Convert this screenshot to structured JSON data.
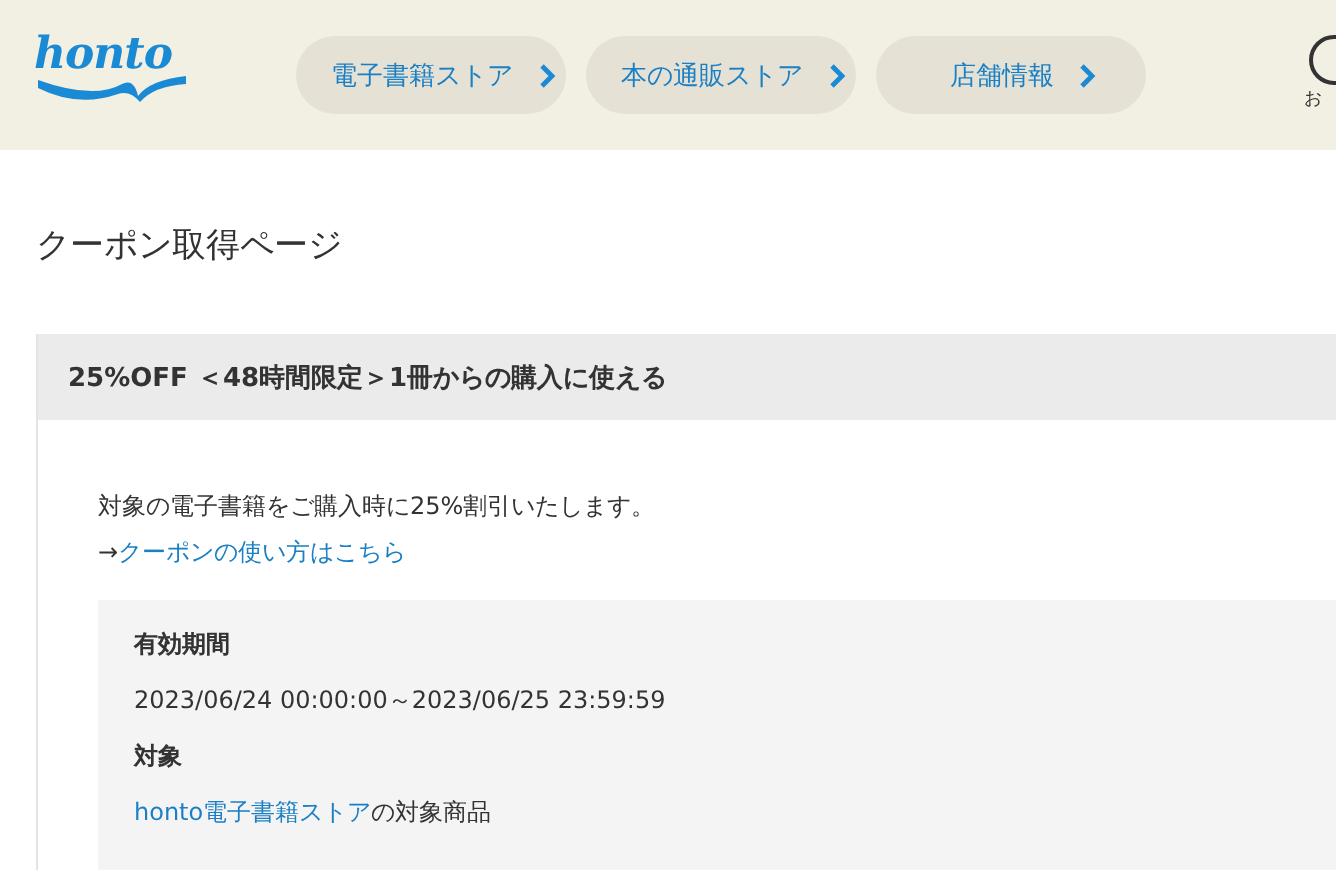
{
  "header": {
    "logo": "honto",
    "nav": [
      {
        "label": "電子書籍ストア"
      },
      {
        "label": "本の通販ストア"
      },
      {
        "label": "店舗情報"
      }
    ],
    "notice_label": "お"
  },
  "page_title": "クーポン取得ページ",
  "coupon": {
    "title": "25%OFF ＜48時間限定＞1冊からの購入に使える",
    "description": "対象の電子書籍をご購入時に25%割引いたします。",
    "howto": {
      "arrow": "→",
      "link": "クーポンの使い方はこちら"
    },
    "details": [
      {
        "label": "有効期間",
        "value": "2023/06/24 00:00:00～2023/06/25 23:59:59"
      },
      {
        "label": "対象",
        "link": "honto電子書籍ストア",
        "value": "の対象商品"
      }
    ]
  }
}
